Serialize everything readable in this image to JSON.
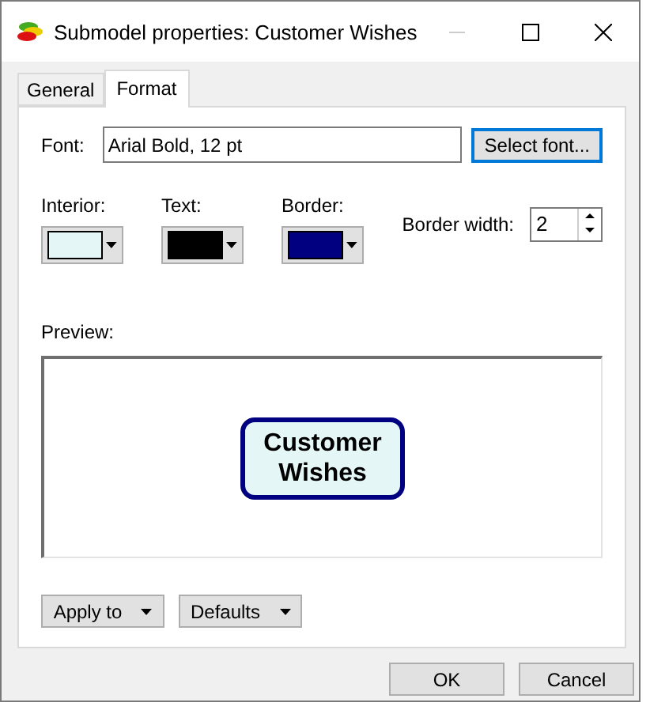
{
  "window": {
    "title": "Submodel properties: Customer Wishes"
  },
  "tabs": [
    {
      "label": "General",
      "selected": false
    },
    {
      "label": "Format",
      "selected": true
    }
  ],
  "font": {
    "label": "Font:",
    "value": "Arial Bold, 12 pt",
    "button": "Select font..."
  },
  "colors": [
    {
      "label": "Interior:",
      "color": "#e4f6f6"
    },
    {
      "label": "Text:",
      "color": "#000000"
    },
    {
      "label": "Border:",
      "color": "#000080"
    }
  ],
  "border_width": {
    "label": "Border width:",
    "value": "2"
  },
  "preview": {
    "label": "Preview:",
    "node_text": "Customer Wishes"
  },
  "menu_buttons": [
    "Apply to",
    "Defaults"
  ],
  "buttons": [
    "OK",
    "Cancel"
  ]
}
